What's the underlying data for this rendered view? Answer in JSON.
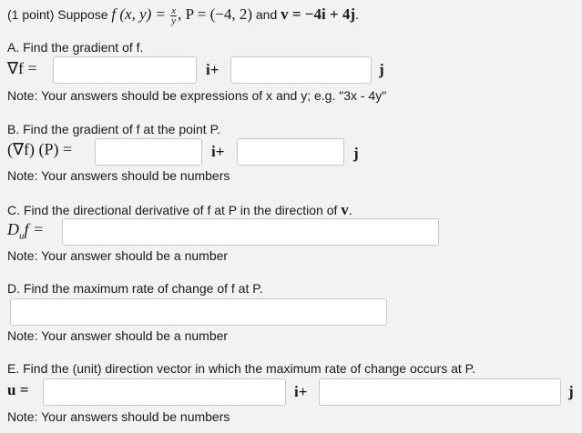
{
  "header": {
    "prefix": "(1 point) Suppose ",
    "function_lhs": "f (x, y) = ",
    "frac_num": "x",
    "frac_den": "y",
    "point": ", P = (−4, 2)",
    "and_text": " and ",
    "vector_def": "v = −4i + 4j",
    "period": "."
  },
  "part_a": {
    "title": "A. Find the gradient of f.",
    "label": "∇f =",
    "i_label": "i+",
    "j_label": "j",
    "note": "Note: Your answers should be expressions of x and y; e.g. \"3x - 4y\"",
    "answer_i": "",
    "answer_j": ""
  },
  "part_b": {
    "title": "B. Find the gradient of f at the point P.",
    "label": "(∇f) (P) =",
    "i_label": "i+",
    "j_label": "j",
    "note": "Note: Your answers should be numbers",
    "answer_i": "",
    "answer_j": ""
  },
  "part_c": {
    "title_text": "C. Find the directional derivative of f at P in the direction of ",
    "title_vec": "v",
    "title_end": ".",
    "label": "D",
    "label_sub": "u",
    "label_rest": "f =",
    "note": "Note: Your answer should be a number",
    "answer": ""
  },
  "part_d": {
    "title": "D. Find the maximum rate of change of f at P.",
    "note": "Note: Your answer should be a number",
    "answer": ""
  },
  "part_e": {
    "title": "E. Find the (unit) direction vector in which the maximum rate of change occurs at P.",
    "label": "u =",
    "i_label": "i+",
    "j_label": "j",
    "note": "Note: Your answers should be numbers",
    "answer_i": "",
    "answer_j": ""
  }
}
